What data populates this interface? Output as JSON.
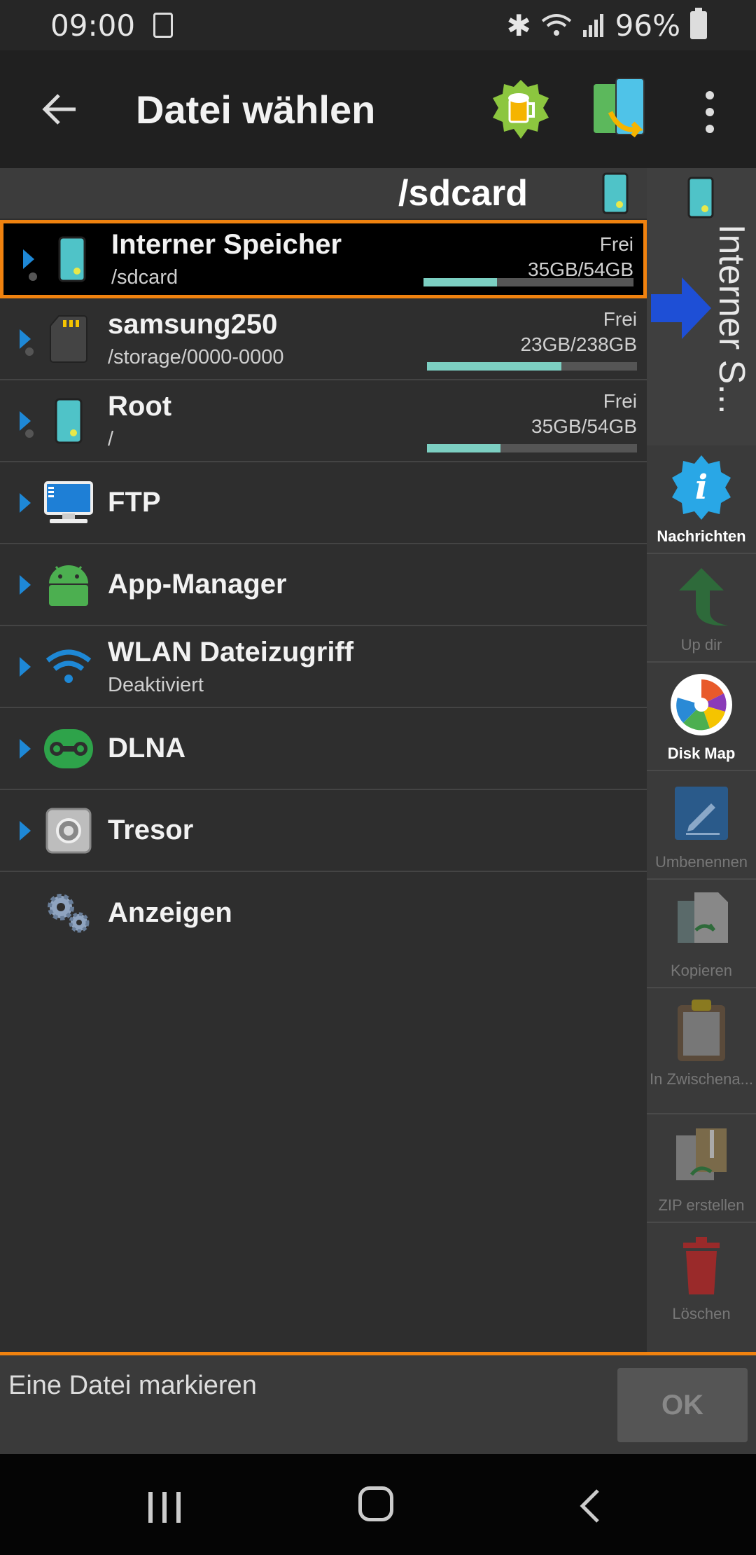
{
  "status": {
    "time": "09:00",
    "battery": "96%"
  },
  "appbar": {
    "title": "Datei wählen"
  },
  "path": {
    "current": "/sdcard"
  },
  "items": [
    {
      "name": "Interner Speicher",
      "sub": "/sdcard",
      "free_label": "Frei",
      "free": "35GB/54GB",
      "used_fraction": 0.35
    },
    {
      "name": "samsung250",
      "sub": "/storage/0000-0000",
      "free_label": "Frei",
      "free": "23GB/238GB",
      "used_fraction": 0.64
    },
    {
      "name": "Root",
      "sub": "/",
      "free_label": "Frei",
      "free": "35GB/54GB",
      "used_fraction": 0.35
    },
    {
      "name": "FTP"
    },
    {
      "name": "App-Manager"
    },
    {
      "name": "WLAN Dateizugriff",
      "sub": "Deaktiviert"
    },
    {
      "name": "DLNA"
    },
    {
      "name": "Tresor"
    },
    {
      "name": "Anzeigen"
    }
  ],
  "sidebar": {
    "header": "Interner S...",
    "tools": [
      {
        "label": "Nachrichten"
      },
      {
        "label": "Up dir"
      },
      {
        "label": "Disk Map"
      },
      {
        "label": "Umbenennen"
      },
      {
        "label": "Kopieren"
      },
      {
        "label": "In Zwischena..."
      },
      {
        "label": "ZIP erstellen"
      },
      {
        "label": "Löschen"
      }
    ]
  },
  "footer": {
    "prompt": "Eine Datei markieren",
    "ok": "OK"
  }
}
